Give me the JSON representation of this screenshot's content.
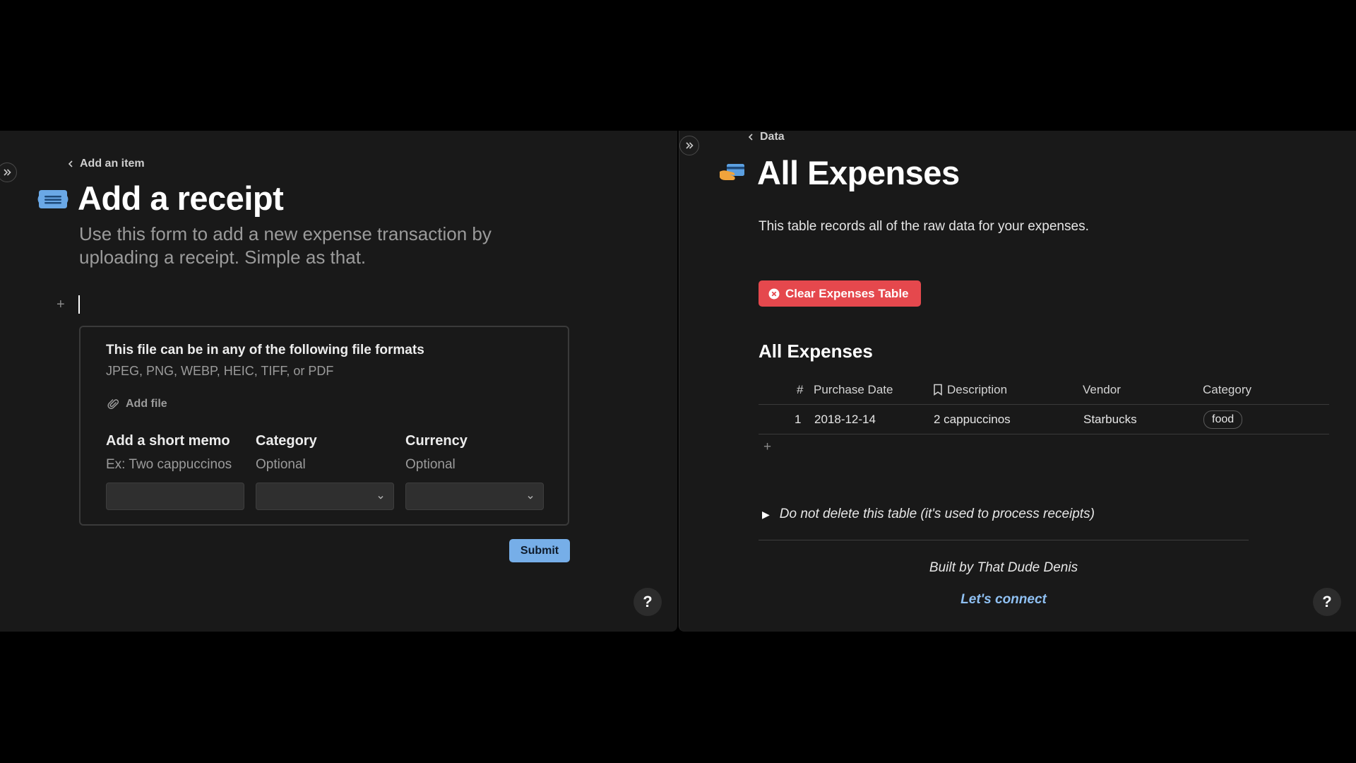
{
  "left": {
    "breadcrumb": "Add an item",
    "title": "Add a receipt",
    "subtitle": "Use this form to add a new expense transaction by uploading a receipt. Simple as that.",
    "add_block": "+",
    "form": {
      "heading": "This file can be in any of the following file formats",
      "formats": "JPEG, PNG, WEBP, HEIC, TIFF, or PDF",
      "add_file": "Add file",
      "fields": [
        {
          "label": "Add a short memo",
          "hint": "Ex: Two cappuccinos",
          "value": ""
        },
        {
          "label": "Category",
          "hint": "Optional",
          "value": ""
        },
        {
          "label": "Currency",
          "hint": "Optional",
          "value": ""
        }
      ],
      "submit": "Submit"
    },
    "help": "?"
  },
  "right": {
    "breadcrumb": "Data",
    "title": "All Expenses",
    "description": "This table records all of the raw data for your expenses.",
    "clear_button": "Clear Expenses Table",
    "section_title": "All Expenses",
    "table": {
      "columns": [
        "#",
        "Purchase Date",
        "Description",
        "Vendor",
        "Category"
      ],
      "rows": [
        {
          "num": "1",
          "date": "2018-12-14",
          "description": "2 cappuccinos",
          "vendor": "Starbucks",
          "category": "food"
        }
      ]
    },
    "add_row": "+",
    "toggle": "Do not delete this table (it's used to process receipts)",
    "built_by": "Built by That Dude Denis",
    "connect": "Let's connect",
    "help": "?"
  },
  "colors": {
    "background": "#191919",
    "accent": "#76aee8",
    "danger": "#e5484d",
    "link": "#8fc0f2"
  },
  "icons": [
    "expand-sidebar-icon",
    "chevron-left-icon",
    "receipt-icon",
    "credit-card-hand-icon",
    "paperclip-icon",
    "chevron-down-icon",
    "x-circle-icon",
    "bookmark-icon",
    "triangle-right-icon"
  ]
}
